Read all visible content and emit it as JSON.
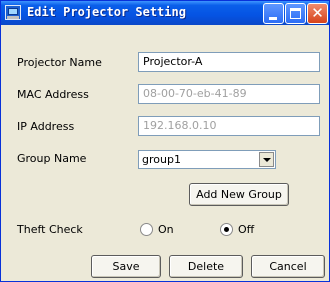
{
  "window": {
    "title": "Edit Projector Setting",
    "app_icon": "projector-icon",
    "controls": {
      "minimize": "minimize-icon",
      "maximize": "maximize-icon",
      "close_glyph": "✕"
    }
  },
  "form": {
    "projector_name": {
      "label": "Projector Name",
      "value": "Projector-A"
    },
    "mac_address": {
      "label": "MAC Address",
      "value": "08-00-70-eb-41-89"
    },
    "ip_address": {
      "label": "IP Address",
      "value": "192.168.0.10"
    },
    "group_name": {
      "label": "Group Name",
      "selected": "group1"
    },
    "add_group_label": "Add New Group",
    "theft_check": {
      "label": "Theft Check",
      "on_label": "On",
      "off_label": "Off",
      "selected": "Off"
    }
  },
  "buttons": {
    "save": "Save",
    "delete": "Delete",
    "cancel": "Cancel"
  }
}
